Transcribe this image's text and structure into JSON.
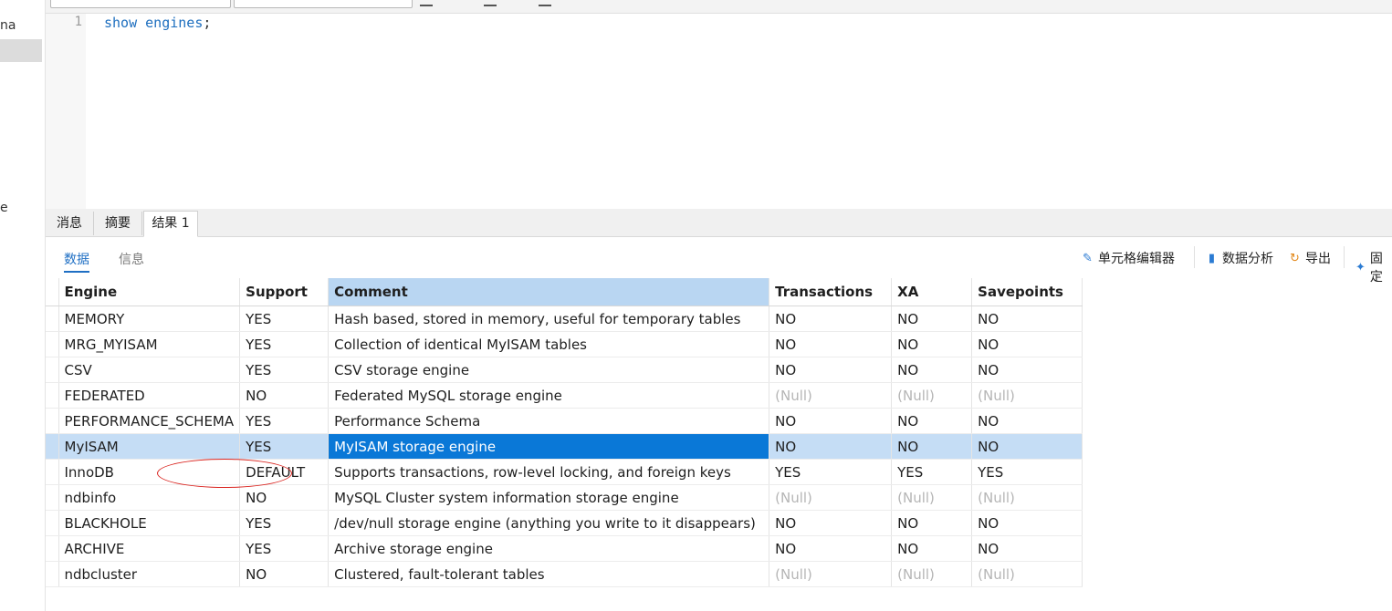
{
  "left_nav": {
    "fragment_top": "na",
    "fragment_bottom": "e"
  },
  "editor": {
    "line_number": "1",
    "sql_keyword_1": "show",
    "sql_keyword_2": "engines",
    "sql_terminator": ";"
  },
  "result_tabs": [
    "消息",
    "摘要",
    "结果 1"
  ],
  "sub_tabs": [
    "数据",
    "信息"
  ],
  "actions": {
    "cell_editor": "单元格编辑器",
    "data_analysis": "数据分析",
    "export": "导出",
    "pin": "固定"
  },
  "table": {
    "columns": [
      "Engine",
      "Support",
      "Comment",
      "Transactions",
      "XA",
      "Savepoints"
    ],
    "rows": [
      [
        "MEMORY",
        "YES",
        "Hash based, stored in memory, useful for temporary tables",
        "NO",
        "NO",
        "NO"
      ],
      [
        "MRG_MYISAM",
        "YES",
        "Collection of identical MyISAM tables",
        "NO",
        "NO",
        "NO"
      ],
      [
        "CSV",
        "YES",
        "CSV storage engine",
        "NO",
        "NO",
        "NO"
      ],
      [
        "FEDERATED",
        "NO",
        "Federated MySQL storage engine",
        "(Null)",
        "(Null)",
        "(Null)"
      ],
      [
        "PERFORMANCE_SCHEMA",
        "YES",
        "Performance Schema",
        "NO",
        "NO",
        "NO"
      ],
      [
        "MyISAM",
        "YES",
        "MyISAM storage engine",
        "NO",
        "NO",
        "NO"
      ],
      [
        "InnoDB",
        "DEFAULT",
        "Supports transactions, row-level locking, and foreign keys",
        "YES",
        "YES",
        "YES"
      ],
      [
        "ndbinfo",
        "NO",
        "MySQL Cluster system information storage engine",
        "(Null)",
        "(Null)",
        "(Null)"
      ],
      [
        "BLACKHOLE",
        "YES",
        "/dev/null storage engine (anything you write to it disappears)",
        "NO",
        "NO",
        "NO"
      ],
      [
        "ARCHIVE",
        "YES",
        "Archive storage engine",
        "NO",
        "NO",
        "NO"
      ],
      [
        "ndbcluster",
        "NO",
        "Clustered, fault-tolerant tables",
        "(Null)",
        "(Null)",
        "(Null)"
      ]
    ]
  },
  "colors": {
    "accent": "#1f6fc4",
    "selection": "#0a78d7",
    "row_highlight": "#c5ddf5",
    "annotation": "#d9231e"
  }
}
